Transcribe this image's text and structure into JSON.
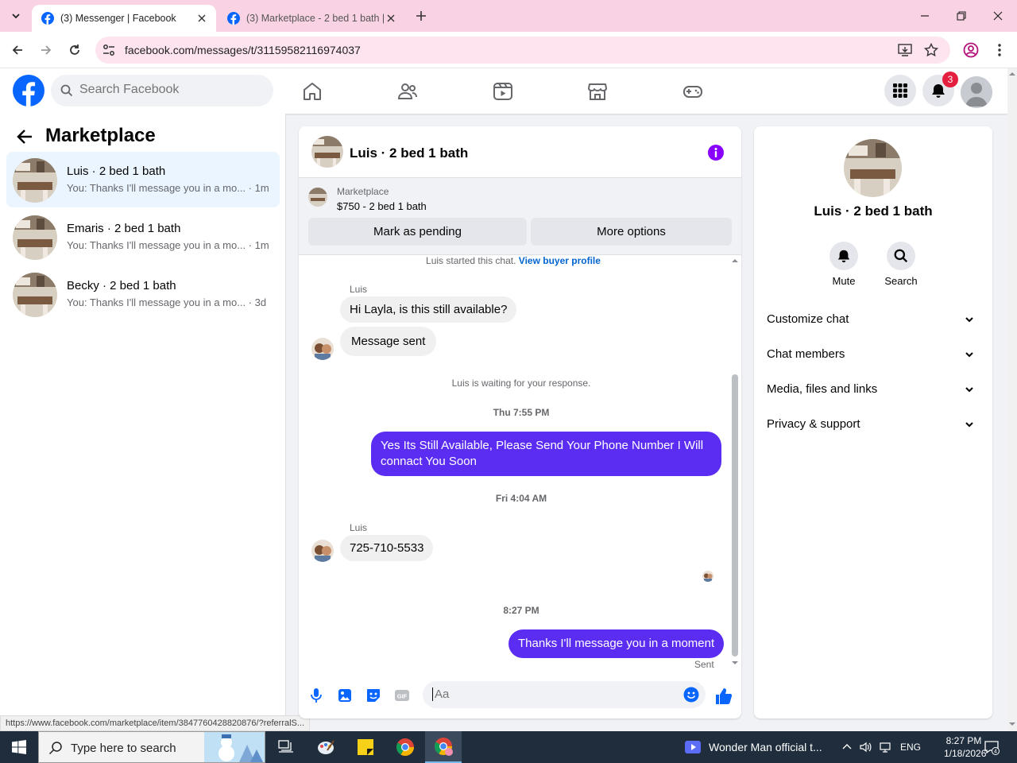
{
  "browser": {
    "tabs": [
      {
        "title": "(3) Messenger | Facebook",
        "active": true
      },
      {
        "title": "(3) Marketplace - 2 bed 1 bath |",
        "active": false
      }
    ],
    "url": "facebook.com/messages/t/31159582116974037"
  },
  "fb_header": {
    "search_placeholder": "Search Facebook",
    "notification_count": "3",
    "brand_color": "#0866ff"
  },
  "left_panel": {
    "title": "Marketplace",
    "conversations": [
      {
        "name": "Luis · 2 bed 1 bath",
        "preview": "You: Thanks I'll message you in a mo... · 1m",
        "active": true
      },
      {
        "name": "Emaris · 2 bed 1 bath",
        "preview": "You: Thanks I'll message you in a mo... · 1m",
        "active": false
      },
      {
        "name": "Becky · 2 bed 1 bath",
        "preview": "You: Thanks I'll message you in a mo... · 3d",
        "active": false
      }
    ]
  },
  "status_url": "https://www.facebook.com/marketplace/item/3847760428820876/?referralS...",
  "chat": {
    "title": "Luis · 2 bed 1 bath",
    "listing": {
      "kicker": "Marketplace",
      "title": "$750 - 2 bed 1 bath",
      "btn_pending": "Mark as pending",
      "btn_more": "More options"
    },
    "started_text": "Luis started this chat.",
    "view_profile": "View buyer profile",
    "sender_1": "Luis",
    "msg_1": "Hi Layla, is this still available?",
    "msg_2": "Message sent",
    "waiting_text": "Luis is waiting for your response.",
    "time_1": "Thu 7:55 PM",
    "msg_3": "Yes Its Still Available, Please Send Your Phone Number I Will connact You Soon",
    "time_2": "Fri 4:04 AM",
    "sender_2": "Luis",
    "msg_4": "725-710-5533",
    "time_3": "8:27 PM",
    "msg_5": "Thanks I'll message you in a moment",
    "sent_label": "Sent",
    "input_placeholder": "Aa",
    "outgoing_color": "#5b2cf1"
  },
  "right_panel": {
    "title": "Luis · 2 bed 1 bath",
    "mute_label": "Mute",
    "search_label": "Search",
    "sections": [
      "Customize chat",
      "Chat members",
      "Media, files and links",
      "Privacy & support"
    ]
  },
  "taskbar": {
    "search_text": "Type here to search",
    "media_title": "Wonder Man official t...",
    "language": "ENG",
    "time": "8:27 PM",
    "date": "1/18/2026",
    "notification_count": "4"
  }
}
